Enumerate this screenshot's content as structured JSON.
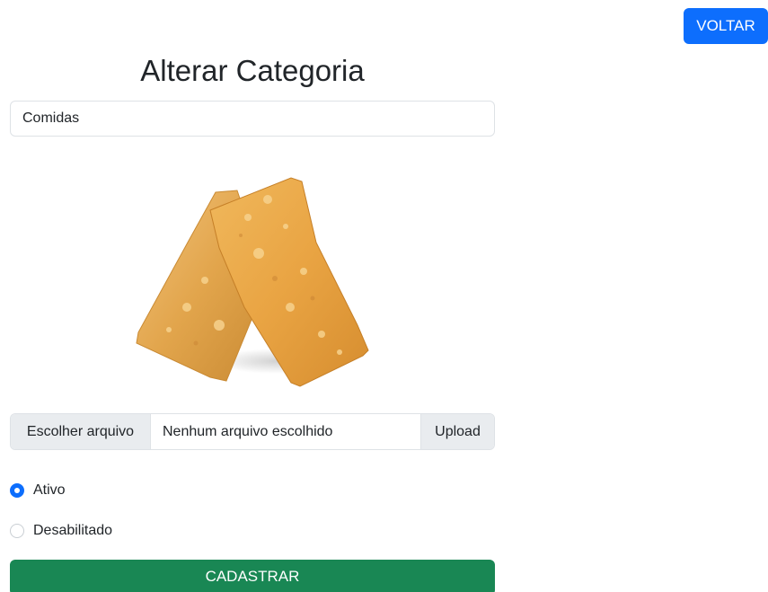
{
  "header": {
    "back_label": "VOLTAR"
  },
  "form": {
    "title": "Alterar Categoria",
    "name_value": "Comidas",
    "file": {
      "choose_label": "Escolher arquivo",
      "no_file_text": "Nenhum arquivo escolhido",
      "upload_label": "Upload"
    },
    "status": {
      "options": [
        {
          "label": "Ativo",
          "checked": true
        },
        {
          "label": "Desabilitado",
          "checked": false
        }
      ]
    },
    "submit_label": "CADASTRAR"
  },
  "colors": {
    "primary": "#0d6efd",
    "success": "#198754",
    "border": "#dee2e6",
    "addon_bg": "#e9ecef"
  }
}
